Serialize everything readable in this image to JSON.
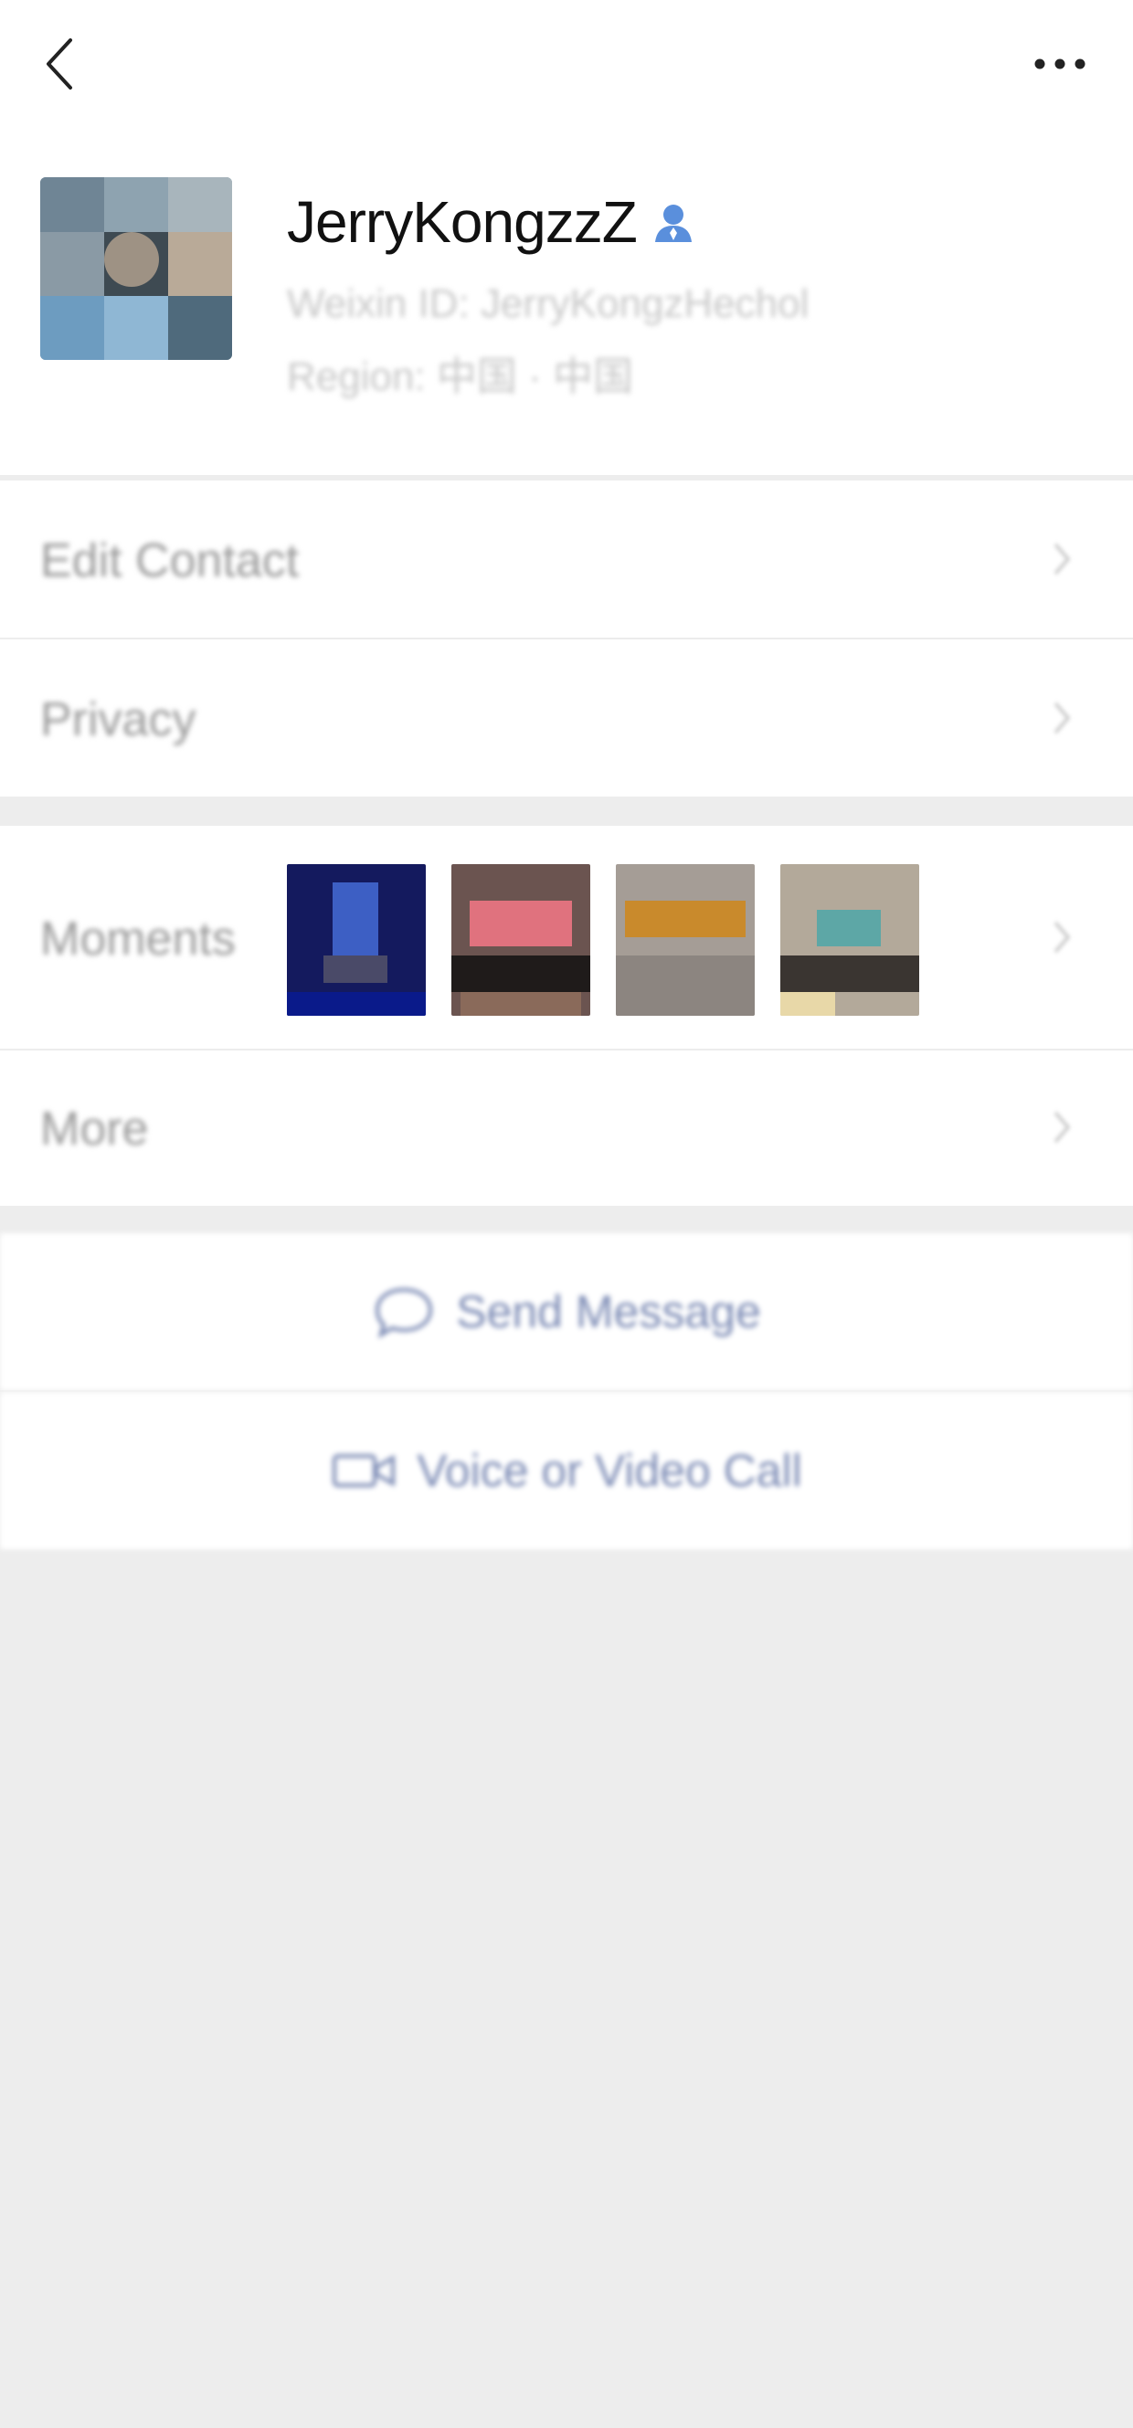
{
  "nav": {
    "back_icon": "chevron-left-icon",
    "more_icon": "more-horizontal-icon"
  },
  "profile": {
    "display_name": "JerryKongzzZ",
    "contact_badge_icon": "person-icon",
    "weixin_id": "Weixin ID: JerryKongzHechol",
    "region": "Region: 中国 · 中国"
  },
  "menu": {
    "edit_contact": "Edit Contact",
    "privacy": "Privacy",
    "moments": "Moments",
    "more": "More"
  },
  "actions": {
    "send_message": "Send Message",
    "voice_video_call": "Voice or Video Call"
  },
  "colors": {
    "accent": "#5a8fdc",
    "link": "#7b8ab4",
    "background": "#ededed",
    "card": "#ffffff"
  }
}
